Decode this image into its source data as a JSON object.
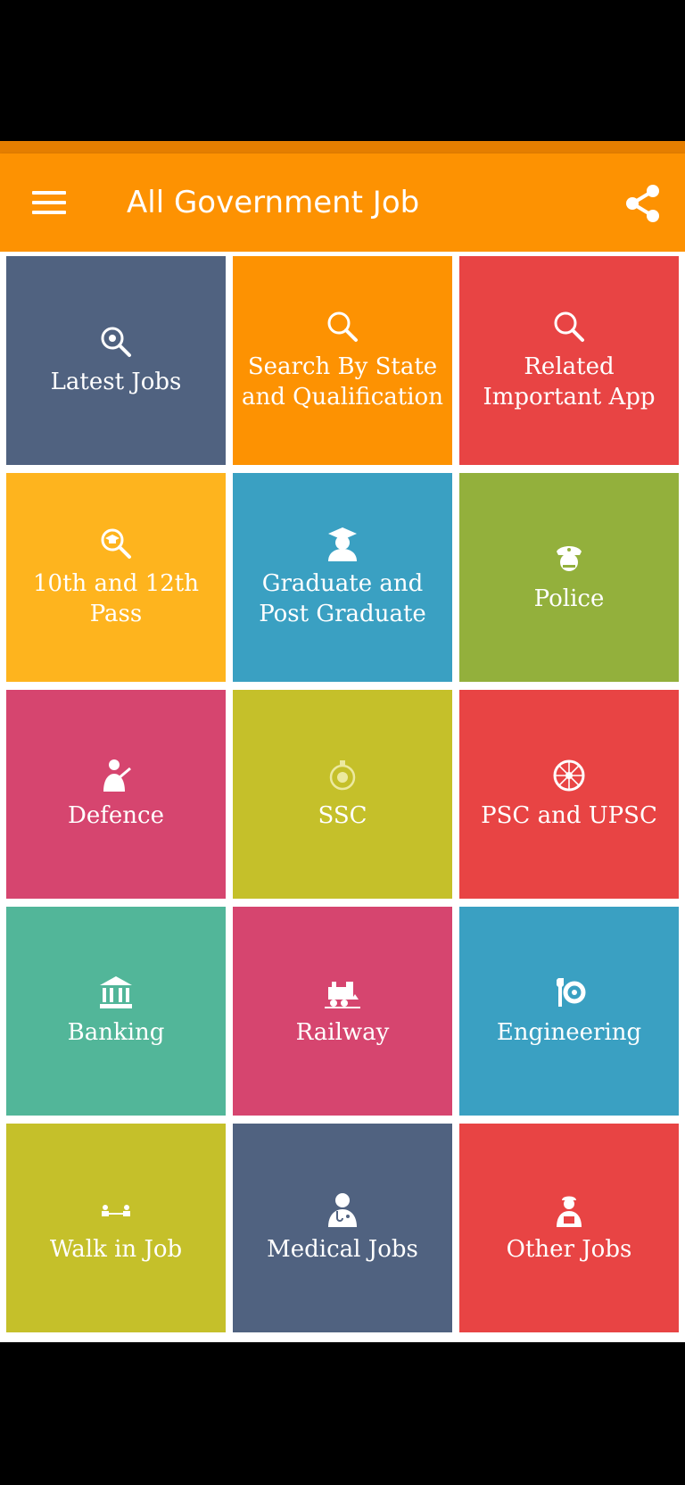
{
  "app_bar": {
    "title": "All Government Job",
    "background": "#fd9202"
  },
  "tiles": [
    {
      "label": "Latest Jobs",
      "icon": "search-jobs-icon",
      "color": "#506280"
    },
    {
      "label": "Search By State and Qualification",
      "icon": "search-icon",
      "color": "#fd9202"
    },
    {
      "label": "Related Important App",
      "icon": "search-icon",
      "color": "#e84444"
    },
    {
      "label": "10th and 12th Pass",
      "icon": "search-graduation-icon",
      "color": "#feb41e"
    },
    {
      "label": "Graduate and Post Graduate",
      "icon": "graduate-icon",
      "color": "#3aa0c2"
    },
    {
      "label": "Police",
      "icon": "police-icon",
      "color": "#93b03c"
    },
    {
      "label": "Defence",
      "icon": "soldier-icon",
      "color": "#d6456f"
    },
    {
      "label": "SSC",
      "icon": "emblem-icon",
      "color": "#c5c02a"
    },
    {
      "label": "PSC and UPSC",
      "icon": "chakra-icon",
      "color": "#e84444"
    },
    {
      "label": "Banking",
      "icon": "bank-icon",
      "color": "#52b699"
    },
    {
      "label": "Railway",
      "icon": "train-icon",
      "color": "#d6456f"
    },
    {
      "label": "Engineering",
      "icon": "engineering-icon",
      "color": "#3aa0c2"
    },
    {
      "label": "Walk in Job",
      "icon": "walk-in-icon",
      "color": "#c5c02a"
    },
    {
      "label": "Medical Jobs",
      "icon": "doctor-icon",
      "color": "#506280"
    },
    {
      "label": "Other Jobs",
      "icon": "worker-icon",
      "color": "#e84444"
    }
  ]
}
